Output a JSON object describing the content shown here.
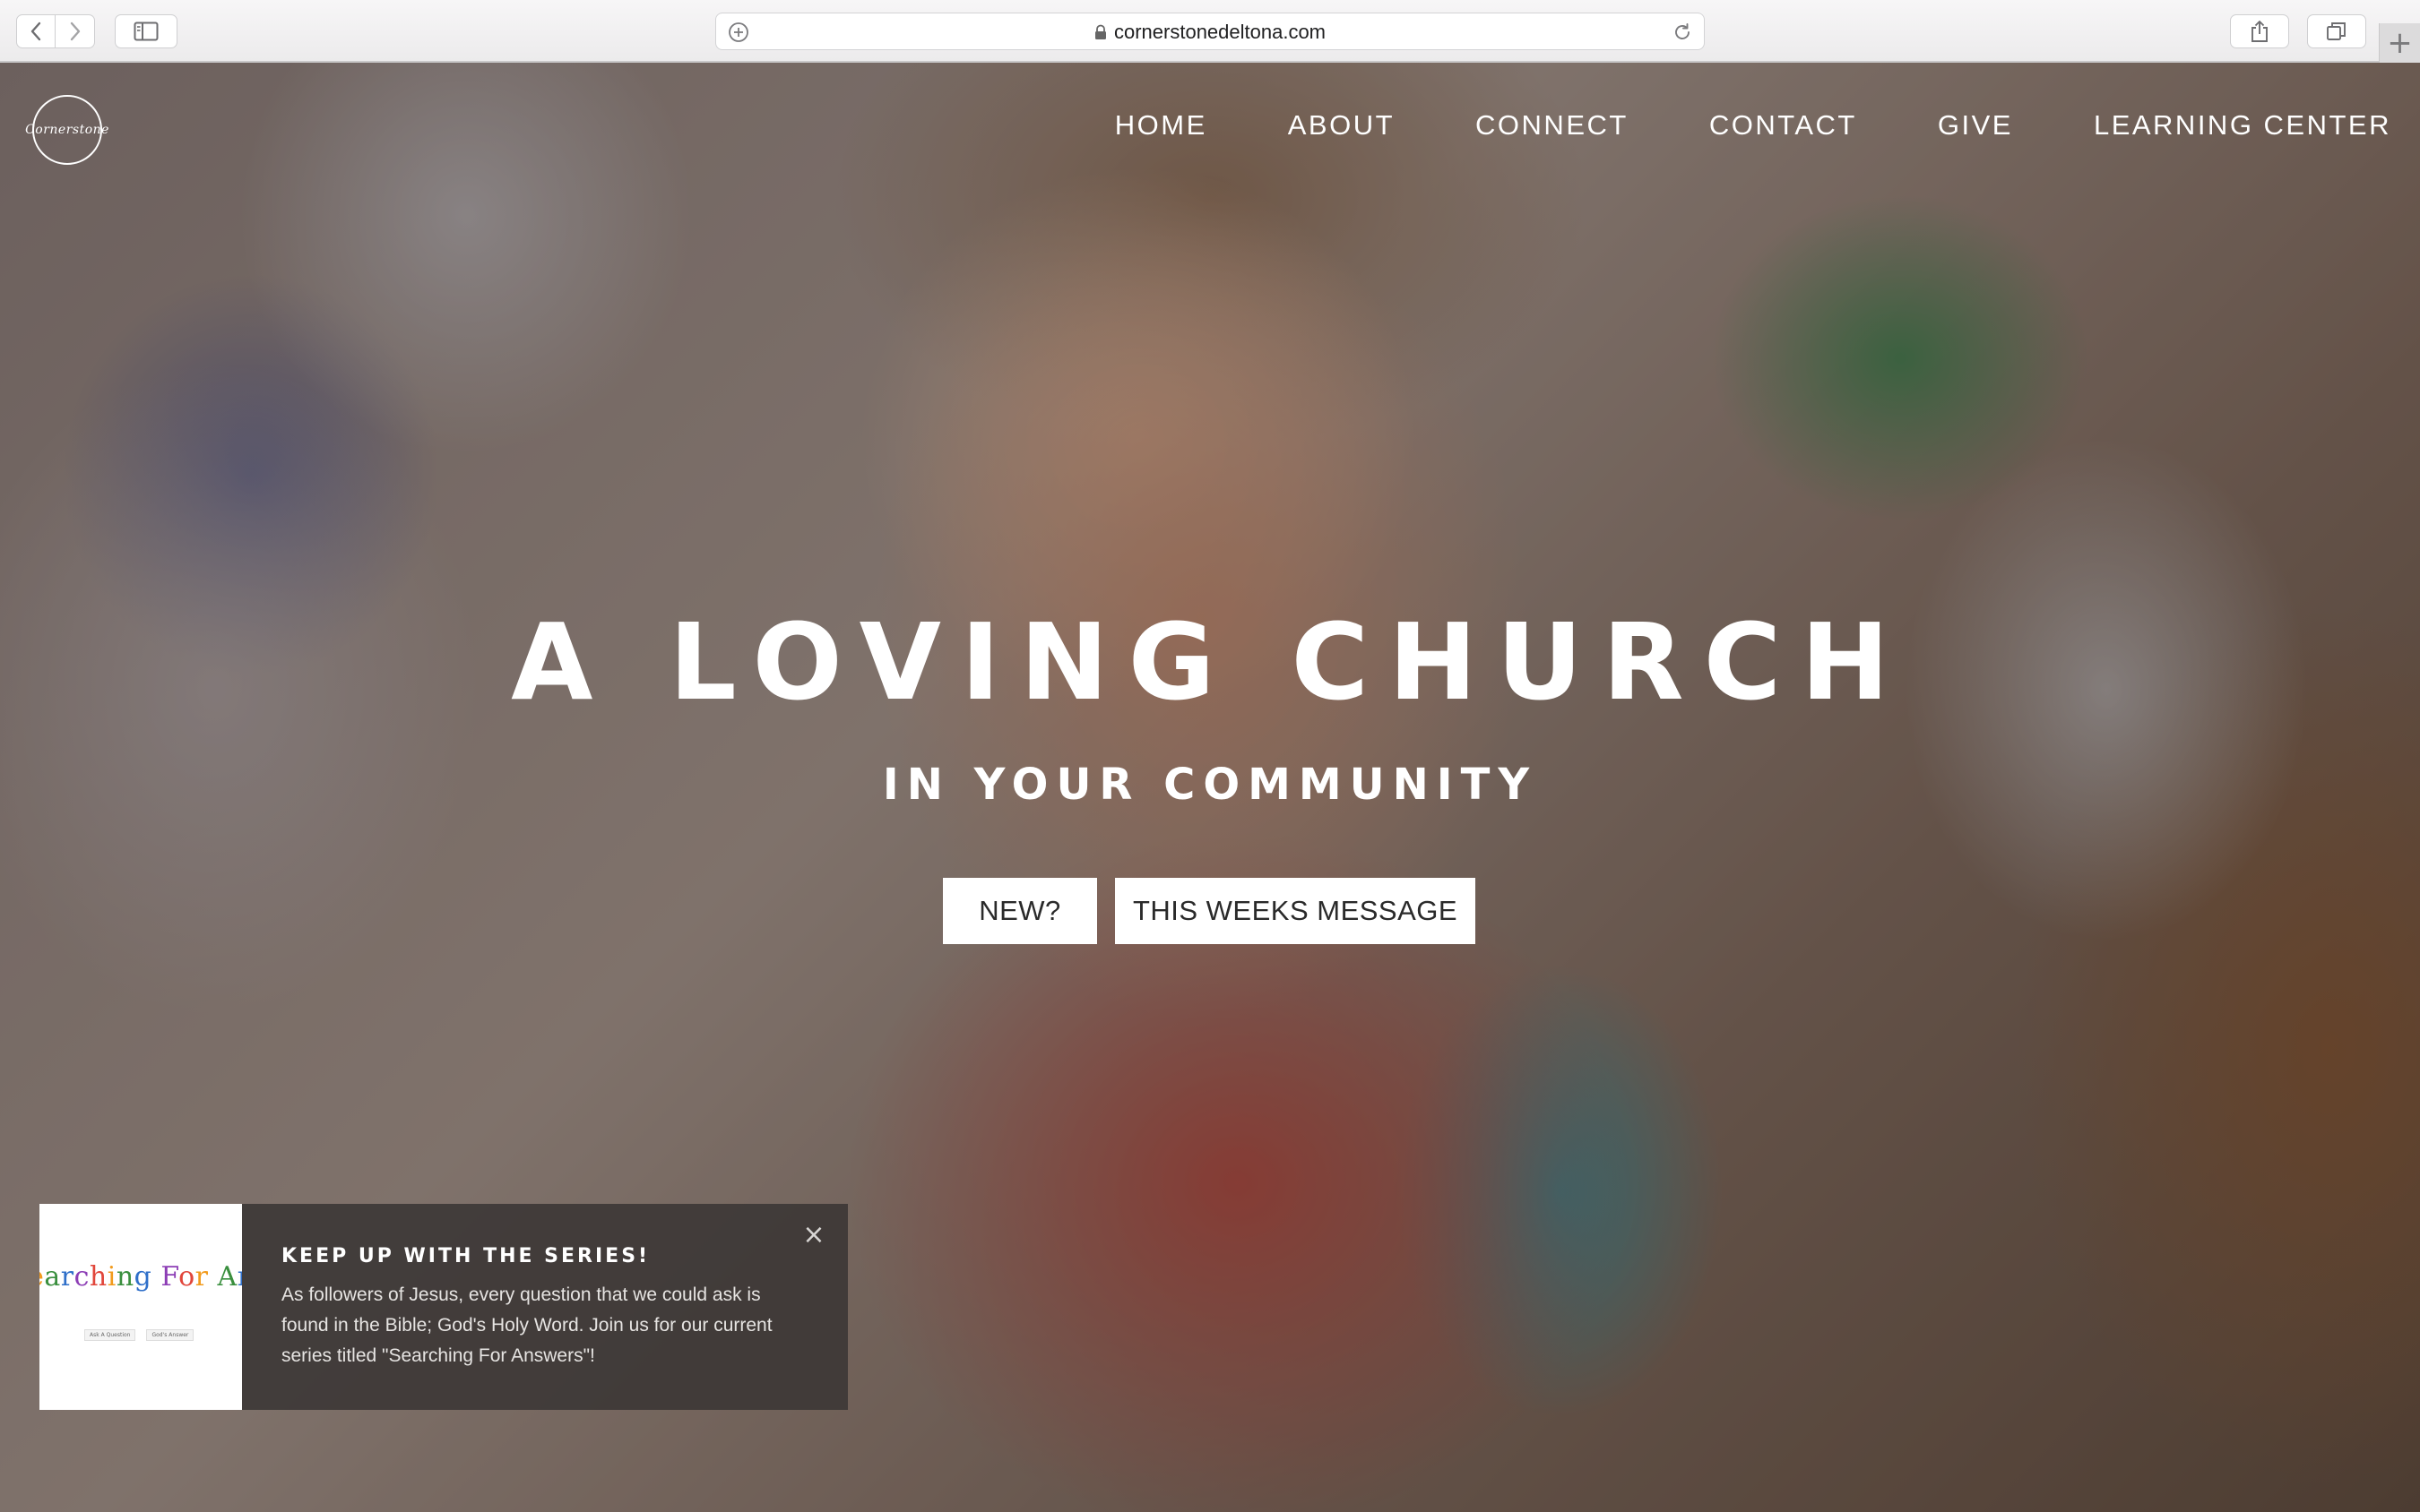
{
  "browser": {
    "url": "cornerstonedeltona.com",
    "icons": {
      "back": "chevron-left-icon",
      "forward": "chevron-right-icon",
      "sidebar": "sidebar-icon",
      "add": "plus-circle-icon",
      "lock": "lock-icon",
      "reload": "reload-icon",
      "share": "share-icon",
      "tabs": "tabs-icon",
      "new_tab": "plus-icon"
    },
    "new_tab_glyph": "+"
  },
  "site": {
    "logo_text": "Cornerstone",
    "nav": [
      {
        "label": "HOME"
      },
      {
        "label": "ABOUT"
      },
      {
        "label": "CONNECT"
      },
      {
        "label": "CONTACT"
      },
      {
        "label": "GIVE"
      },
      {
        "label": "LEARNING CENTER"
      }
    ]
  },
  "hero": {
    "title": "A LOVING CHURCH",
    "subtitle": "IN YOUR COMMUNITY",
    "buttons": {
      "new": "NEW?",
      "message": "THIS WEEKS MESSAGE"
    }
  },
  "popup": {
    "thumbnail_title": "Searching For Answers",
    "thumbnail_buttons": [
      "Ask A Question",
      "God's Answer"
    ],
    "heading": "KEEP UP WITH THE SERIES!",
    "text": "As followers of Jesus, every question that we could ask is found in the Bible; God's Holy Word. Join us for our current series titled \"Searching For Answers\"!",
    "close_glyph": "×"
  },
  "colors": {
    "overlay": "#000000",
    "button_bg": "#ffffff",
    "popup_bg": "#3a3634",
    "thumb_letters": [
      "#e1463b",
      "#f29b1d",
      "#3a8f3e",
      "#2f6fc9",
      "#8c3db5"
    ]
  }
}
